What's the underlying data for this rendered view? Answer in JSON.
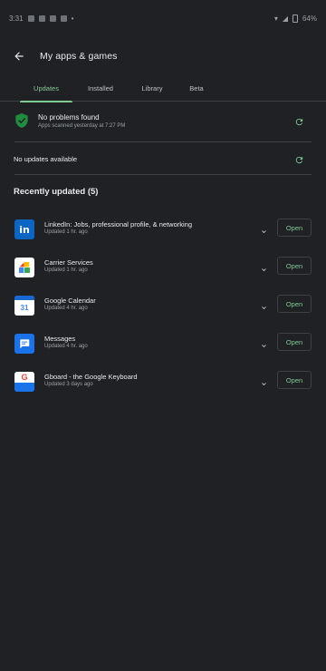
{
  "status_bar": {
    "time": "3:31",
    "battery": "64%"
  },
  "header": {
    "title": "My apps & games"
  },
  "tabs": [
    {
      "label": "Updates",
      "active": true
    },
    {
      "label": "Installed",
      "active": false
    },
    {
      "label": "Library",
      "active": false
    },
    {
      "label": "Beta",
      "active": false
    }
  ],
  "protect": {
    "title": "No problems found",
    "subtitle": "Apps scanned yesterday at 7:27 PM"
  },
  "updates": {
    "status": "No updates available"
  },
  "recently_updated": {
    "heading": "Recently updated (5)",
    "apps": [
      {
        "name": "LinkedIn: Jobs, professional profile, & networking",
        "status": "Updated 1 hr. ago",
        "icon": "linkedin-icon",
        "open_label": "Open"
      },
      {
        "name": "Carrier Services",
        "status": "Updated 1 hr. ago",
        "icon": "carrier-services-icon",
        "open_label": "Open"
      },
      {
        "name": "Google Calendar",
        "status": "Updated 4 hr. ago",
        "icon": "google-calendar-icon",
        "open_label": "Open"
      },
      {
        "name": "Messages",
        "status": "Updated 4 hr. ago",
        "icon": "messages-icon",
        "open_label": "Open"
      },
      {
        "name": "Gboard - the Google Keyboard",
        "status": "Updated 3 days ago",
        "icon": "gboard-icon",
        "open_label": "Open"
      }
    ]
  },
  "colors": {
    "background": "#202124",
    "accent": "#81c995",
    "text_primary": "#e8eaed",
    "text_secondary": "#9aa0a6",
    "divider": "#3c4043"
  }
}
